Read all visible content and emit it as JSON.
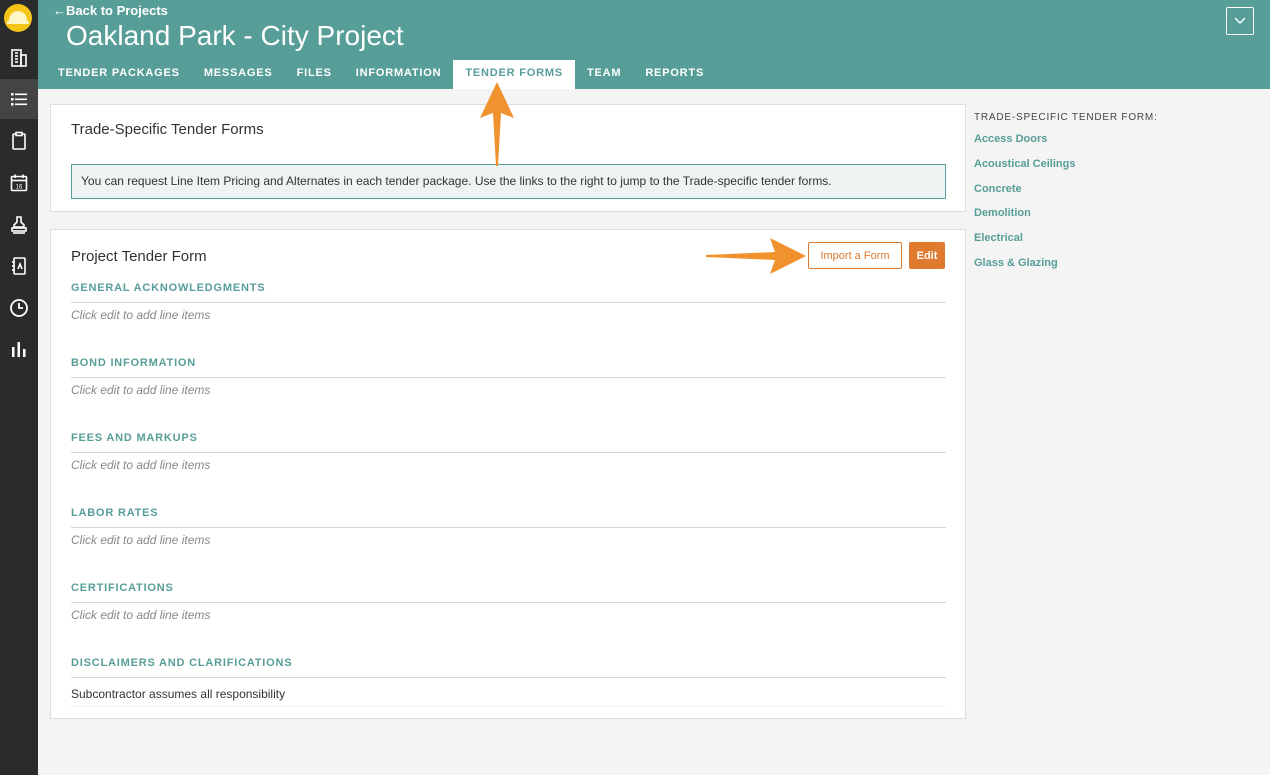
{
  "app": {
    "rail_icons": [
      "hard-hat-logo",
      "building-icon",
      "list-icon",
      "clipboard-icon",
      "calendar-icon",
      "stamp-icon",
      "address-book-icon",
      "clock-icon",
      "bar-chart-icon"
    ],
    "calendar_day": "16"
  },
  "header": {
    "back_label": "←Back to Projects",
    "title": "Oakland Park - City Project",
    "tabs": [
      {
        "label": "TENDER PACKAGES"
      },
      {
        "label": "MESSAGES"
      },
      {
        "label": "FILES"
      },
      {
        "label": "INFORMATION"
      },
      {
        "label": "TENDER FORMS"
      },
      {
        "label": "TEAM"
      },
      {
        "label": "REPORTS"
      }
    ],
    "active_tab": "TENDER FORMS"
  },
  "trade_panel": {
    "title": "Trade-Specific Tender Forms",
    "info": "You can request Line Item Pricing and Alternates in each tender package. Use the links to the right to jump to the Trade-specific tender forms."
  },
  "project_panel": {
    "title": "Project Tender Form",
    "import_label": "Import a Form",
    "edit_label": "Edit",
    "sections": [
      {
        "heading": "GENERAL ACKNOWLEDGMENTS",
        "item": "Click edit to add line items"
      },
      {
        "heading": "BOND INFORMATION",
        "item": "Click edit to add line items"
      },
      {
        "heading": "FEES AND MARKUPS",
        "item": "Click edit to add line items"
      },
      {
        "heading": "LABOR RATES",
        "item": "Click edit to add line items"
      },
      {
        "heading": "CERTIFICATIONS",
        "item": "Click edit to add line items"
      },
      {
        "heading": "DISCLAIMERS AND CLARIFICATIONS",
        "item": "Subcontractor assumes all responsibility"
      }
    ]
  },
  "sidebar": {
    "heading": "TRADE-SPECIFIC TENDER FORM:",
    "links": [
      "Access Doors",
      "Acoustical Ceilings",
      "Concrete",
      "Demolition",
      "Electrical",
      "Glass & Glazing"
    ]
  },
  "colors": {
    "teal": "#579e98",
    "orange": "#e07a2f",
    "arrow": "#f0922e",
    "rail": "#2b2b2b"
  }
}
